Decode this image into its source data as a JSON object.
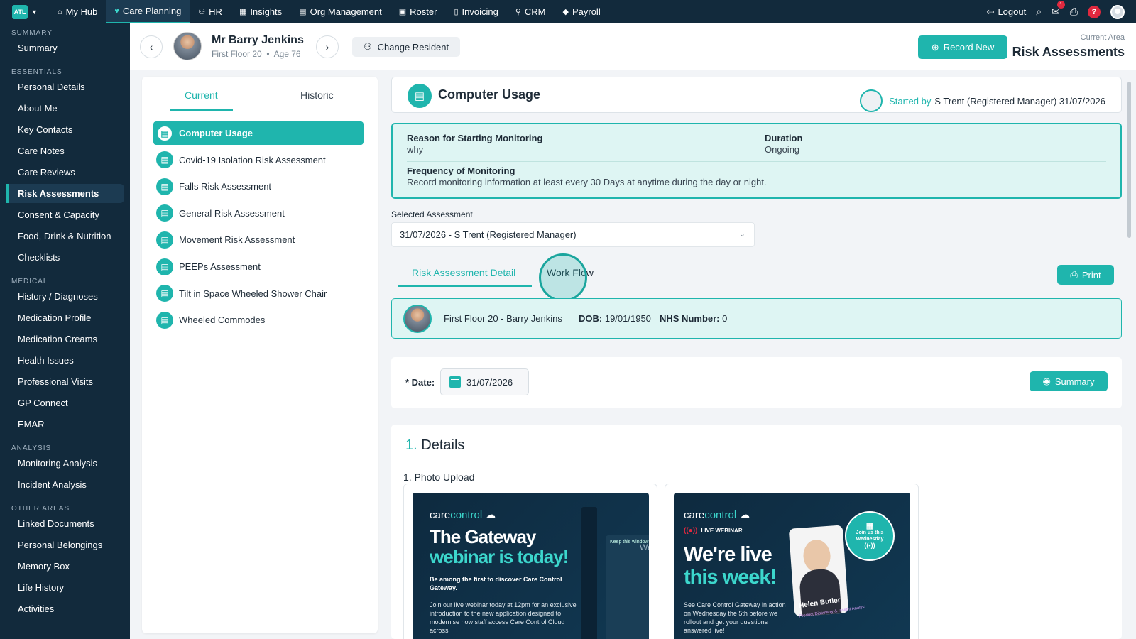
{
  "topbar": {
    "logo": "ATL",
    "nav": [
      {
        "label": "My Hub",
        "icon": "home-icon",
        "glyph": "⌂"
      },
      {
        "label": "Care Planning",
        "icon": "heart-icon",
        "glyph": "♥"
      },
      {
        "label": "HR",
        "icon": "users-icon",
        "glyph": "⚇"
      },
      {
        "label": "Insights",
        "icon": "chart-icon",
        "glyph": "▦"
      },
      {
        "label": "Org Management",
        "icon": "building-icon",
        "glyph": "▤"
      },
      {
        "label": "Roster",
        "icon": "calendar-icon",
        "glyph": "▣"
      },
      {
        "label": "Invoicing",
        "icon": "file-icon",
        "glyph": "▯"
      },
      {
        "label": "CRM",
        "icon": "user-plus-icon",
        "glyph": "⚲"
      },
      {
        "label": "Payroll",
        "icon": "tag-icon",
        "glyph": "◆"
      }
    ],
    "logout": "Logout",
    "mail_badge": "1",
    "help": "?"
  },
  "sidebar": {
    "sections": [
      {
        "title": "Summary",
        "items": [
          "Summary"
        ]
      },
      {
        "title": "Essentials",
        "items": [
          "Personal Details",
          "About Me",
          "Key Contacts",
          "Care Notes",
          "Care Reviews",
          "Risk Assessments",
          "Consent & Capacity",
          "Food, Drink & Nutrition",
          "Checklists"
        ]
      },
      {
        "title": "Medical",
        "items": [
          "History / Diagnoses",
          "Medication Profile",
          "Medication Creams",
          "Health Issues",
          "Professional Visits",
          "GP Connect",
          "EMAR"
        ]
      },
      {
        "title": "Analysis",
        "items": [
          "Monitoring Analysis",
          "Incident Analysis"
        ]
      },
      {
        "title": "Other Areas",
        "items": [
          "Linked Documents",
          "Personal Belongings",
          "Memory Box",
          "Life History",
          "Activities"
        ]
      }
    ],
    "active": "Risk Assessments"
  },
  "header": {
    "resident_name": "Mr Barry Jenkins",
    "resident_location": "First Floor 20",
    "resident_age": "Age 76",
    "change_resident": "Change Resident",
    "record_new": "Record New",
    "current_area_label": "Current Area",
    "current_area": "Risk Assessments"
  },
  "left_panel": {
    "tabs": [
      "Current",
      "Historic"
    ],
    "items": [
      {
        "label": "Computer Usage",
        "active": true
      },
      {
        "label": "Covid-19 Isolation Risk Assessment"
      },
      {
        "label": "Falls Risk Assessment"
      },
      {
        "label": "General Risk Assessment"
      },
      {
        "label": "Movement Risk Assessment"
      },
      {
        "label": "PEEPs Assessment"
      },
      {
        "label": "Tilt in Space Wheeled Shower Chair"
      },
      {
        "label": "Wheeled Commodes"
      }
    ]
  },
  "assessment": {
    "title": "Computer Usage",
    "started_by_label": "Started by",
    "started_by": "S Trent (Registered Manager) 31/07/2026",
    "reason_label": "Reason for Starting Monitoring",
    "reason": "why",
    "duration_label": "Duration",
    "duration": "Ongoing",
    "frequency_label": "Frequency of Monitoring",
    "frequency": "Record monitoring information at least every 30 Days at anytime during the day or night.",
    "selected_label": "Selected Assessment",
    "selected": "31/07/2026 - S Trent (Registered Manager)",
    "tabs": [
      "Risk Assessment Detail",
      "Work Flow"
    ],
    "print": "Print",
    "patient_line": "First Floor 20 - Barry Jenkins",
    "dob_label": "DOB:",
    "dob": "19/01/1950",
    "nhs_label": "NHS Number:",
    "nhs": "0",
    "date_label": "* Date:",
    "date": "31/07/2026",
    "summary": "Summary",
    "details_num": "1.",
    "details_title": "Details",
    "photo_label": "1. Photo Upload"
  },
  "posters": {
    "p1": {
      "brand_a": "care",
      "brand_b": "control",
      "h1": "The Gateway",
      "h2": "webinar is today!",
      "sub": "Be among the first to discover Care Control Gateway.",
      "body": "Join our live webinar today at 12pm for an exclusive introduction to the new application designed to modernise how staff access Care Control Cloud across",
      "peek": "Keep this window",
      "we": "We"
    },
    "p2": {
      "brand_a": "care",
      "brand_b": "control",
      "live": "LIVE WEBINAR",
      "h1": "We're live",
      "h2": "this week!",
      "circle": "Join us this Wednesday",
      "name": "Helen Butler",
      "role": "Product Discovery & Insight Analyst",
      "body": "See Care Control Gateway in action on Wednesday the 5th before we rollout and get your questions answered live!"
    }
  },
  "colors": {
    "accent": "#1fb5ad",
    "nav_bg": "#122a3c",
    "badge": "#e0293f"
  }
}
